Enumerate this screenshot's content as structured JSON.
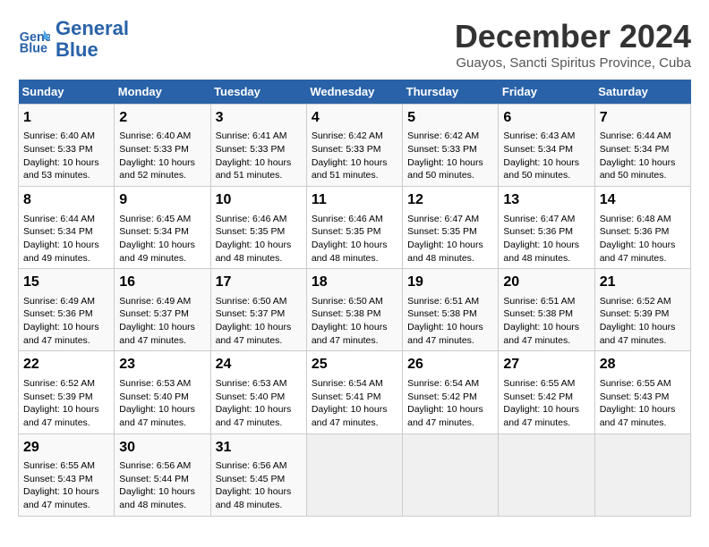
{
  "logo": {
    "line1": "General",
    "line2": "Blue"
  },
  "title": "December 2024",
  "subtitle": "Guayos, Sancti Spiritus Province, Cuba",
  "days_of_week": [
    "Sunday",
    "Monday",
    "Tuesday",
    "Wednesday",
    "Thursday",
    "Friday",
    "Saturday"
  ],
  "weeks": [
    [
      {
        "day": 1,
        "info": "Sunrise: 6:40 AM\nSunset: 5:33 PM\nDaylight: 10 hours\nand 53 minutes."
      },
      {
        "day": 2,
        "info": "Sunrise: 6:40 AM\nSunset: 5:33 PM\nDaylight: 10 hours\nand 52 minutes."
      },
      {
        "day": 3,
        "info": "Sunrise: 6:41 AM\nSunset: 5:33 PM\nDaylight: 10 hours\nand 51 minutes."
      },
      {
        "day": 4,
        "info": "Sunrise: 6:42 AM\nSunset: 5:33 PM\nDaylight: 10 hours\nand 51 minutes."
      },
      {
        "day": 5,
        "info": "Sunrise: 6:42 AM\nSunset: 5:33 PM\nDaylight: 10 hours\nand 50 minutes."
      },
      {
        "day": 6,
        "info": "Sunrise: 6:43 AM\nSunset: 5:34 PM\nDaylight: 10 hours\nand 50 minutes."
      },
      {
        "day": 7,
        "info": "Sunrise: 6:44 AM\nSunset: 5:34 PM\nDaylight: 10 hours\nand 50 minutes."
      }
    ],
    [
      {
        "day": 8,
        "info": "Sunrise: 6:44 AM\nSunset: 5:34 PM\nDaylight: 10 hours\nand 49 minutes."
      },
      {
        "day": 9,
        "info": "Sunrise: 6:45 AM\nSunset: 5:34 PM\nDaylight: 10 hours\nand 49 minutes."
      },
      {
        "day": 10,
        "info": "Sunrise: 6:46 AM\nSunset: 5:35 PM\nDaylight: 10 hours\nand 48 minutes."
      },
      {
        "day": 11,
        "info": "Sunrise: 6:46 AM\nSunset: 5:35 PM\nDaylight: 10 hours\nand 48 minutes."
      },
      {
        "day": 12,
        "info": "Sunrise: 6:47 AM\nSunset: 5:35 PM\nDaylight: 10 hours\nand 48 minutes."
      },
      {
        "day": 13,
        "info": "Sunrise: 6:47 AM\nSunset: 5:36 PM\nDaylight: 10 hours\nand 48 minutes."
      },
      {
        "day": 14,
        "info": "Sunrise: 6:48 AM\nSunset: 5:36 PM\nDaylight: 10 hours\nand 47 minutes."
      }
    ],
    [
      {
        "day": 15,
        "info": "Sunrise: 6:49 AM\nSunset: 5:36 PM\nDaylight: 10 hours\nand 47 minutes."
      },
      {
        "day": 16,
        "info": "Sunrise: 6:49 AM\nSunset: 5:37 PM\nDaylight: 10 hours\nand 47 minutes."
      },
      {
        "day": 17,
        "info": "Sunrise: 6:50 AM\nSunset: 5:37 PM\nDaylight: 10 hours\nand 47 minutes."
      },
      {
        "day": 18,
        "info": "Sunrise: 6:50 AM\nSunset: 5:38 PM\nDaylight: 10 hours\nand 47 minutes."
      },
      {
        "day": 19,
        "info": "Sunrise: 6:51 AM\nSunset: 5:38 PM\nDaylight: 10 hours\nand 47 minutes."
      },
      {
        "day": 20,
        "info": "Sunrise: 6:51 AM\nSunset: 5:38 PM\nDaylight: 10 hours\nand 47 minutes."
      },
      {
        "day": 21,
        "info": "Sunrise: 6:52 AM\nSunset: 5:39 PM\nDaylight: 10 hours\nand 47 minutes."
      }
    ],
    [
      {
        "day": 22,
        "info": "Sunrise: 6:52 AM\nSunset: 5:39 PM\nDaylight: 10 hours\nand 47 minutes."
      },
      {
        "day": 23,
        "info": "Sunrise: 6:53 AM\nSunset: 5:40 PM\nDaylight: 10 hours\nand 47 minutes."
      },
      {
        "day": 24,
        "info": "Sunrise: 6:53 AM\nSunset: 5:40 PM\nDaylight: 10 hours\nand 47 minutes."
      },
      {
        "day": 25,
        "info": "Sunrise: 6:54 AM\nSunset: 5:41 PM\nDaylight: 10 hours\nand 47 minutes."
      },
      {
        "day": 26,
        "info": "Sunrise: 6:54 AM\nSunset: 5:42 PM\nDaylight: 10 hours\nand 47 minutes."
      },
      {
        "day": 27,
        "info": "Sunrise: 6:55 AM\nSunset: 5:42 PM\nDaylight: 10 hours\nand 47 minutes."
      },
      {
        "day": 28,
        "info": "Sunrise: 6:55 AM\nSunset: 5:43 PM\nDaylight: 10 hours\nand 47 minutes."
      }
    ],
    [
      {
        "day": 29,
        "info": "Sunrise: 6:55 AM\nSunset: 5:43 PM\nDaylight: 10 hours\nand 47 minutes."
      },
      {
        "day": 30,
        "info": "Sunrise: 6:56 AM\nSunset: 5:44 PM\nDaylight: 10 hours\nand 48 minutes."
      },
      {
        "day": 31,
        "info": "Sunrise: 6:56 AM\nSunset: 5:45 PM\nDaylight: 10 hours\nand 48 minutes."
      },
      null,
      null,
      null,
      null
    ]
  ]
}
